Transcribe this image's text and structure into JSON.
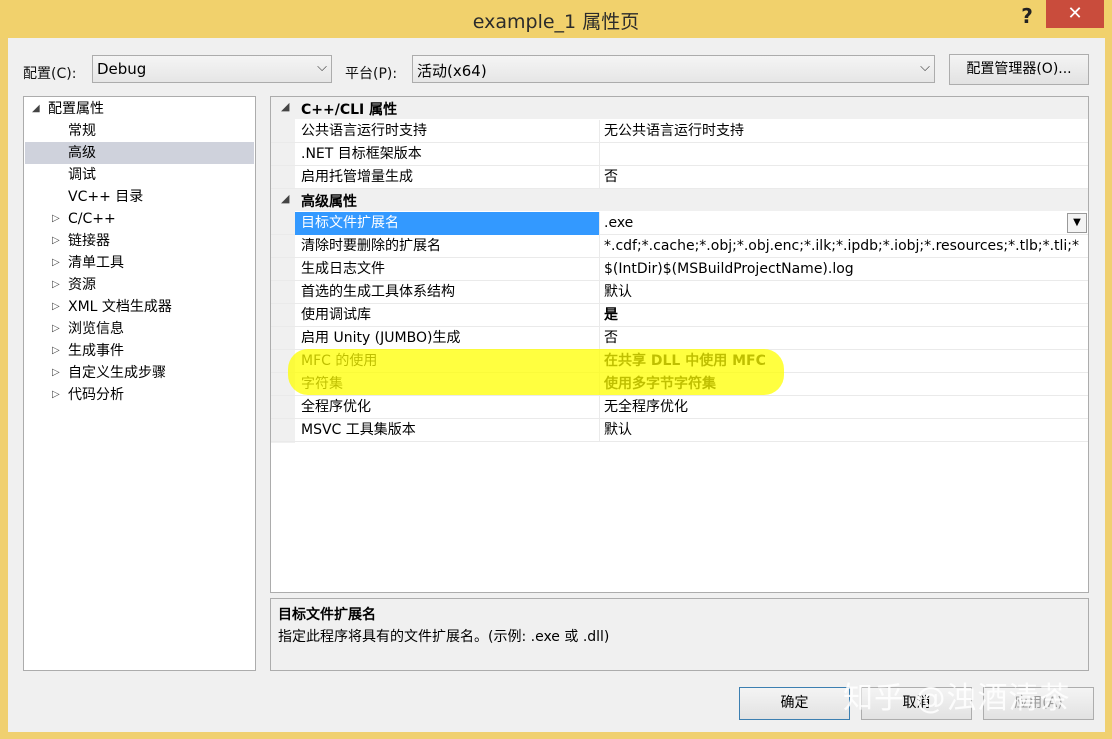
{
  "window": {
    "title": "example_1 属性页",
    "help": "?",
    "close": "✕"
  },
  "toolbar": {
    "config_label": "配置(C):",
    "config_value": "Debug",
    "platform_label": "平台(P):",
    "platform_value": "活动(x64)",
    "config_manager": "配置管理器(O)..."
  },
  "tree": {
    "items": [
      {
        "label": "配置属性",
        "expander": "◢"
      },
      {
        "label": "常规"
      },
      {
        "label": "高级"
      },
      {
        "label": "调试"
      },
      {
        "label": "VC++ 目录"
      },
      {
        "label": "C/C++",
        "expander": "▷"
      },
      {
        "label": "链接器",
        "expander": "▷"
      },
      {
        "label": "清单工具",
        "expander": "▷"
      },
      {
        "label": "资源",
        "expander": "▷"
      },
      {
        "label": "XML 文档生成器",
        "expander": "▷"
      },
      {
        "label": "浏览信息",
        "expander": "▷"
      },
      {
        "label": "生成事件",
        "expander": "▷"
      },
      {
        "label": "自定义生成步骤",
        "expander": "▷"
      },
      {
        "label": "代码分析",
        "expander": "▷"
      }
    ],
    "selected": "高级"
  },
  "grid": {
    "categories": [
      {
        "title": "C++/CLI 属性",
        "expander": "◢"
      },
      {
        "title": "高级属性",
        "expander": "◢"
      }
    ],
    "cli_rows": [
      {
        "name": "公共语言运行时支持",
        "value": "无公共语言运行时支持"
      },
      {
        "name": ".NET 目标框架版本",
        "value": ""
      },
      {
        "name": "启用托管增量生成",
        "value": "否"
      }
    ],
    "adv_rows": [
      {
        "name": "目标文件扩展名",
        "value": ".exe"
      },
      {
        "name": "清除时要删除的扩展名",
        "value": "*.cdf;*.cache;*.obj;*.obj.enc;*.ilk;*.ipdb;*.iobj;*.resources;*.tlb;*.tli;*"
      },
      {
        "name": "生成日志文件",
        "value": "$(IntDir)$(MSBuildProjectName).log"
      },
      {
        "name": "首选的生成工具体系结构",
        "value": "默认"
      },
      {
        "name": "使用调试库",
        "value": "是"
      },
      {
        "name": "启用 Unity (JUMBO)生成",
        "value": "否"
      },
      {
        "name": "MFC 的使用",
        "value": "在共享 DLL 中使用 MFC"
      },
      {
        "name": "字符集",
        "value": "使用多字节字符集"
      },
      {
        "name": "全程序优化",
        "value": "无全程序优化"
      },
      {
        "name": "MSVC 工具集版本",
        "value": "默认"
      }
    ],
    "dropdown_arrow": "▼"
  },
  "description": {
    "title": "目标文件扩展名",
    "text": "指定此程序将具有的文件扩展名。(示例: .exe 或 .dll)"
  },
  "buttons": {
    "ok": "确定",
    "cancel": "取消",
    "apply": "应用(A)"
  },
  "watermark": "知乎 @浊酒清茶",
  "colors": {
    "selection": "#3399ff",
    "tree_selection": "#cfd2dc",
    "highlight": "#ffff00",
    "close_button": "#c94c3c"
  }
}
